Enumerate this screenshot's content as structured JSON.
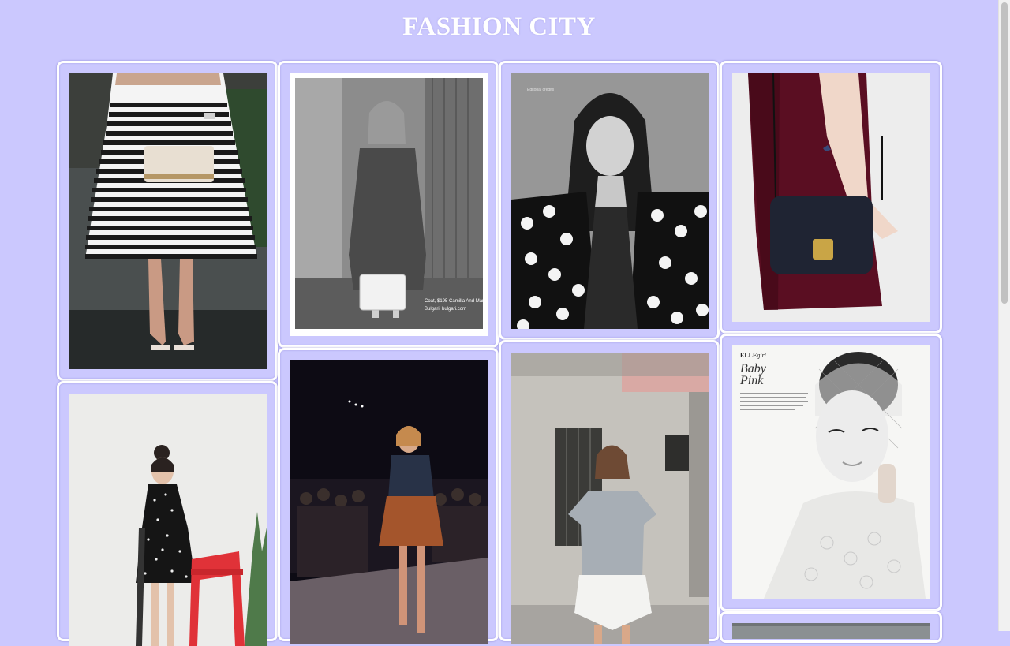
{
  "header": {
    "title": "FASHION CITY"
  },
  "gallery": {
    "photos": [
      {
        "subject": "striped-skirt-clutch"
      },
      {
        "subject": "bw-coat-white-bag"
      },
      {
        "subject": "bw-floral-jacket-portrait"
      },
      {
        "subject": "velvet-dress-navy-bag"
      },
      {
        "subject": "polka-dot-dress-red-chair"
      },
      {
        "subject": "runway-leather-skirt"
      },
      {
        "subject": "grey-tee-white-skort"
      },
      {
        "subject": "baby-pink-magazine-portrait",
        "text": {
          "brand": "ELLE",
          "brand_suffix": "girl",
          "line1": "Baby",
          "line2": "Pink"
        }
      },
      {
        "subject": "partial-photo"
      }
    ]
  }
}
